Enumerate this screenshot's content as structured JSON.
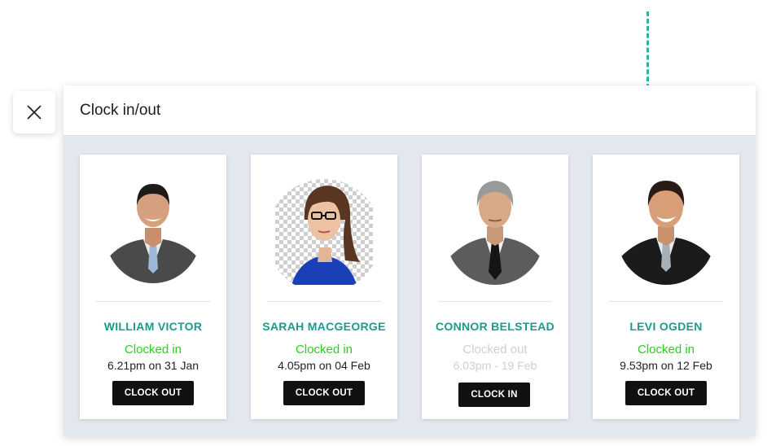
{
  "close_icon": "close-icon",
  "panel": {
    "title": "Clock in/out"
  },
  "cards": [
    {
      "name": "WILLIAM VICTOR",
      "status": "Clocked in",
      "time": "6.21pm on 31 Jan",
      "button": "CLOCK OUT"
    },
    {
      "name": "SARAH MACGEORGE",
      "status": "Clocked in",
      "time": "4.05pm on 04 Feb",
      "button": "CLOCK OUT"
    },
    {
      "name": "CONNOR BELSTEAD",
      "status": "Clocked out",
      "time": "6.03pm - 19 Feb",
      "button": "CLOCK IN"
    },
    {
      "name": "LEVI OGDEN",
      "status": "Clocked in",
      "time": "9.53pm on 12 Feb",
      "button": "CLOCK OUT"
    }
  ],
  "colors": {
    "accent": "#1d9a8c",
    "clocked_in": "#2ecc1f",
    "clocked_out": "#cfcfcf",
    "dash": "#2bb3a3"
  }
}
